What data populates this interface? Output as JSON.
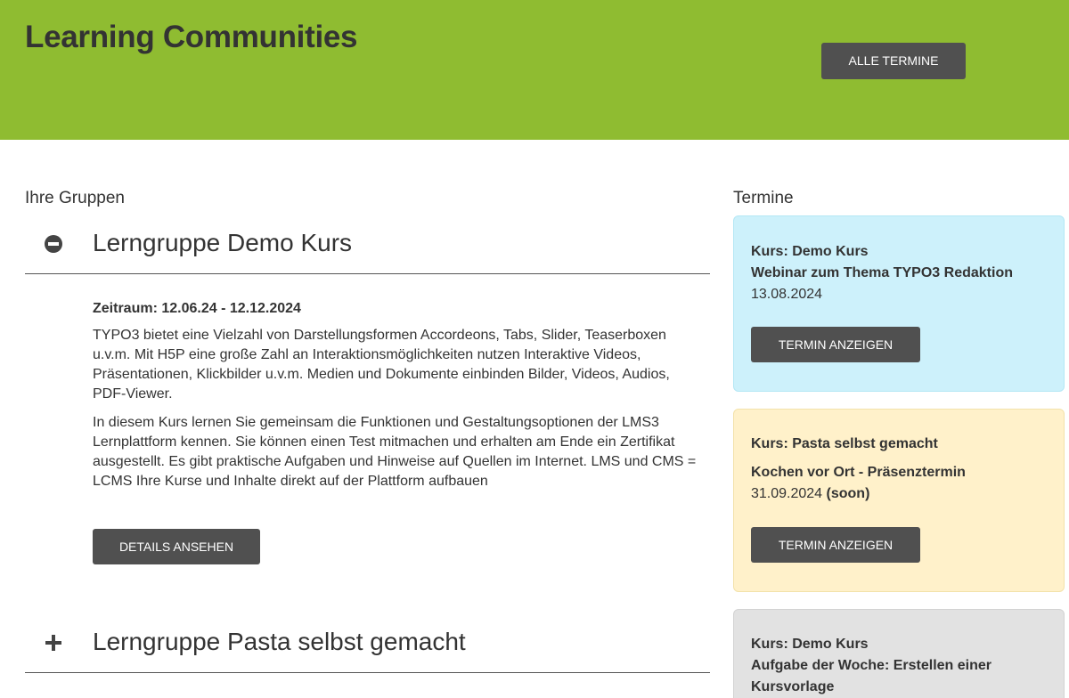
{
  "header": {
    "title": "Learning Communities",
    "all_dates_button": "ALLE TERMINE",
    "background_color": "#8fbc31"
  },
  "groups": {
    "label": "Ihre Gruppen",
    "items": [
      {
        "title": "Lerngruppe Demo Kurs",
        "expanded": true,
        "icon": "minus-circle-icon",
        "period": "Zeitraum: 12.06.24 - 12.12.2024",
        "paragraphs": [
          "TYPO3 bietet eine Vielzahl von Darstellungsformen Accordeons, Tabs, Slider, Teaserboxen u.v.m. Mit H5P eine große Zahl an Interaktionsmöglichkeiten nutzen Interaktive Videos, Präsentationen, Klickbilder u.v.m. Medien und Dokumente einbinden Bilder, Videos, Audios, PDF-Viewer.",
          "In diesem Kurs lernen Sie gemeinsam die Funktionen und Gestaltungsoptionen der LMS3 Lernplattform kennen. Sie können einen Test mitmachen und erhalten am Ende ein Zertifikat ausgestellt. Es gibt praktische Aufgaben und Hinweise auf Quellen im Internet. LMS und CMS = LCMS Ihre Kurse und Inhalte direkt auf der Plattform aufbauen"
        ],
        "details_button": "DETAILS ANSEHEN"
      },
      {
        "title": "Lerngruppe Pasta selbst gemacht",
        "expanded": false,
        "icon": "plus-icon"
      }
    ]
  },
  "termine": {
    "label": "Termine",
    "cards": [
      {
        "course": "Kurs: Demo Kurs",
        "event": "Webinar zum Thema TYPO3 Redaktion",
        "date": "13.08.2024",
        "button": "TERMIN ANZEIGEN",
        "color": "#cdf1fb"
      },
      {
        "course": "Kurs: Pasta selbst gemacht",
        "event": "Kochen vor Ort - Präsenztermin",
        "date": "31.09.2024",
        "date_note": "(soon)",
        "button": "TERMIN ANZEIGEN",
        "color": "#fff1ca"
      },
      {
        "course": "Kurs: Demo Kurs",
        "event": "Aufgabe der Woche: Erstellen einer Kursvorlage",
        "color": "#e2e2e2"
      }
    ]
  }
}
